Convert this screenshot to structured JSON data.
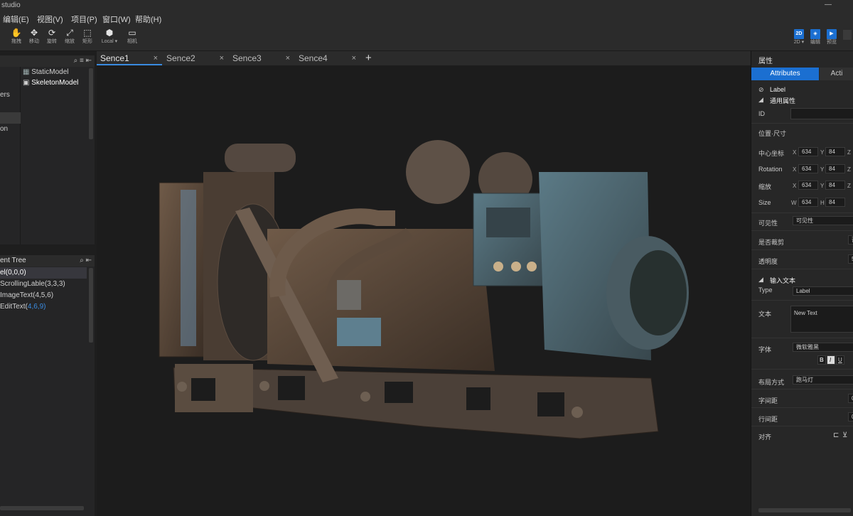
{
  "window": {
    "title": "studio",
    "controls": "—"
  },
  "menu": [
    "编辑(E)",
    "视图(V)",
    "项目(P)",
    "窗口(W)",
    "帮助(H)"
  ],
  "toolbar": {
    "tools": [
      {
        "icon": "hand-icon",
        "label": "拖拽"
      },
      {
        "icon": "move-icon",
        "label": "移动"
      },
      {
        "icon": "rotate-icon",
        "label": "旋转"
      },
      {
        "icon": "scale-icon",
        "label": "缩放"
      },
      {
        "icon": "rect-icon",
        "label": "矩形"
      },
      {
        "icon": "local-icon",
        "label": "Local ▾"
      },
      {
        "icon": "camera-icon",
        "label": "相机"
      }
    ],
    "right": [
      {
        "badge": "2D",
        "label": "2D ▾"
      },
      {
        "badge": "◈",
        "label": "编辑"
      },
      {
        "badge": "▶",
        "label": "预览"
      }
    ]
  },
  "resources": {
    "items": [
      "StaticModel",
      "SkeletonModel"
    ],
    "left_labels": [
      "ers",
      "on"
    ]
  },
  "element_tree": {
    "title": "ent Tree",
    "rows": [
      {
        "text": "el(0,0,0)",
        "extra": ""
      },
      {
        "text": "ScrollingLable(3,3,3)",
        "extra": ""
      },
      {
        "text": "ImageText(4,5,6)",
        "extra": ""
      },
      {
        "text": "EditText(",
        "extra": "4,6,9)"
      }
    ]
  },
  "tabs": [
    "Sence1",
    "Sence2",
    "Sence3",
    "Sence4"
  ],
  "tab_close": "×",
  "tab_add": "+",
  "properties": {
    "title": "属性",
    "tab_active": "Attributes",
    "tab_inactive": "Acti",
    "node_label": "Label",
    "general_section": "通用属性",
    "id_label": "ID",
    "position_size": "位置·尺寸",
    "center_label": "中心坐标",
    "rotation_label": "Rotation",
    "scale_label": "缩放",
    "size_label": "Size",
    "x_val": "634",
    "y_val": "84",
    "axis_x": "X",
    "axis_y": "Y",
    "axis_z": "Z",
    "axis_w": "W",
    "axis_h": "H",
    "visibility_label": "可见性",
    "visibility_value": "可见性",
    "clip_label": "是否裁剪",
    "clip_value": "否",
    "opacity_label": "透明度",
    "opacity_value": "5",
    "input_section": "输入文本",
    "type_label": "Type",
    "type_value": "Label",
    "text_label": "文本",
    "text_value": "New Text",
    "font_label": "字体",
    "font_value": "微软雅黑",
    "style_b": "B",
    "style_i": "I",
    "style_u": "U",
    "layout_label": "布局方式",
    "layout_value": "跑马灯",
    "char_spacing": "字间距",
    "line_spacing": "行间距",
    "align_label": "对齐",
    "spacing_value": "0"
  }
}
